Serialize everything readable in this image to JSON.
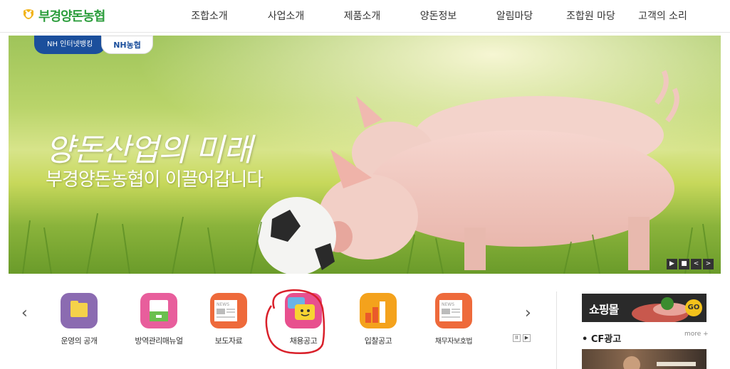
{
  "header": {
    "logo_text": "부경양돈농협",
    "nav": [
      "조합소개",
      "사업소개",
      "제품소개",
      "양돈정보",
      "알림마당",
      "조합원 마당",
      "고객의 소리"
    ]
  },
  "banner": {
    "tab_internet_banking": "NH 인터넷뱅킹",
    "tab_nh": "NH농협",
    "headline": "양돈산업의 미래",
    "subline": "부경양돈농협이 이끌어갑니다",
    "controls": [
      "▶",
      "■",
      "<",
      ">"
    ]
  },
  "quick_menu": {
    "prev": "‹",
    "next": "›",
    "items": [
      {
        "label": "운영의 공개",
        "icon": "folder-icon",
        "color": "#8b6bb1"
      },
      {
        "label": "방역관리매뉴얼",
        "icon": "manual-icon",
        "color": "#e85e9c"
      },
      {
        "label": "보도자료",
        "icon": "news-icon",
        "color": "#ee6a3b"
      },
      {
        "label": "채용공고",
        "icon": "chat-smile-icon",
        "color": "#e8508e"
      },
      {
        "label": "입찰공고",
        "icon": "bar-chart-icon",
        "color": "#f4a21c"
      },
      {
        "label": "채무자보호법",
        "icon": "news-icon",
        "color": "#ee6a3b"
      }
    ],
    "pager": [
      "II",
      "▶"
    ]
  },
  "side": {
    "shop_label": "쇼핑몰",
    "shop_go": "GO",
    "cf_title": "• CF광고",
    "more": "more +"
  },
  "colors": {
    "brand_green": "#2e9e3e",
    "nh_blue": "#1b4f9c",
    "annotation_red": "#d9202a"
  }
}
